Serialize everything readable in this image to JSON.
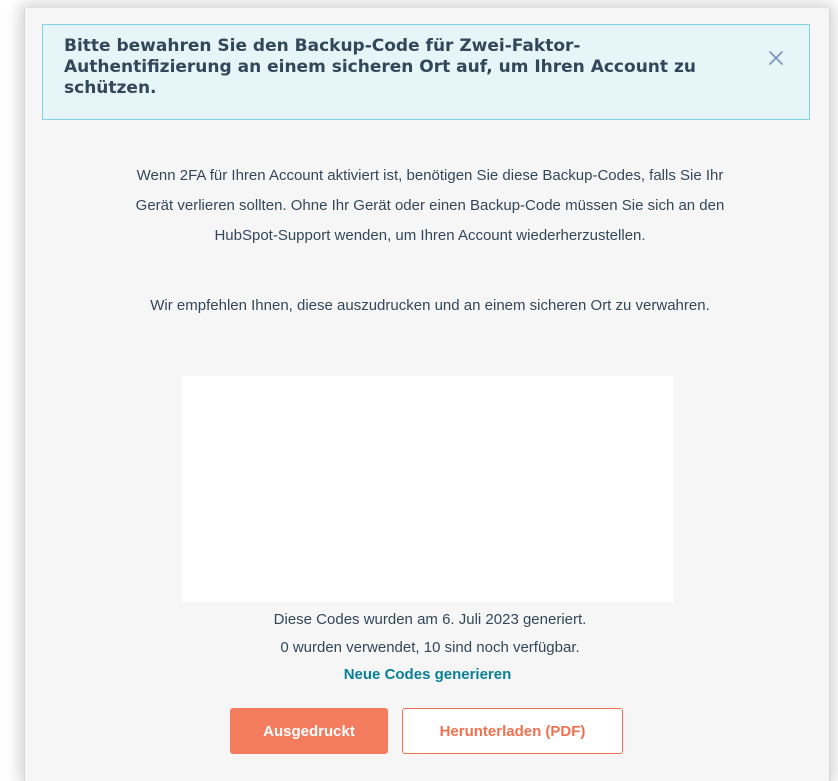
{
  "alert": {
    "message": "Bitte bewahren Sie den Backup-Code für Zwei-Faktor-Authentifizierung an einem sicheren Ort auf, um Ihren Account zu schützen.",
    "close_icon": "close-icon"
  },
  "content": {
    "paragraph_1": "Wenn 2FA für Ihren Account aktiviert ist, benötigen Sie diese Backup-Codes, falls Sie Ihr Gerät verlieren sollten. Ohne Ihr Gerät oder einen Backup-Code müssen Sie sich an den HubSpot-Support wenden, um Ihren Account wiederherzustellen.",
    "paragraph_2": "Wir empfehlen Ihnen, diese auszudrucken und an einem sicheren Ort zu verwahren.",
    "generated_text": "Diese Codes wurden am 6. Juli 2023 generiert.",
    "usage_text": "0 wurden verwendet, 10 sind noch verfügbar.",
    "regenerate_link": "Neue Codes generieren"
  },
  "buttons": {
    "printed_label": "Ausgedruckt",
    "download_label": "Herunterladen (PDF)"
  },
  "colors": {
    "alert_bg": "#e5f5f8",
    "alert_border": "#7fd1de",
    "text": "#33475b",
    "link": "#0a8098",
    "primary": "#f47c5e",
    "secondary_border": "#f0714f"
  }
}
